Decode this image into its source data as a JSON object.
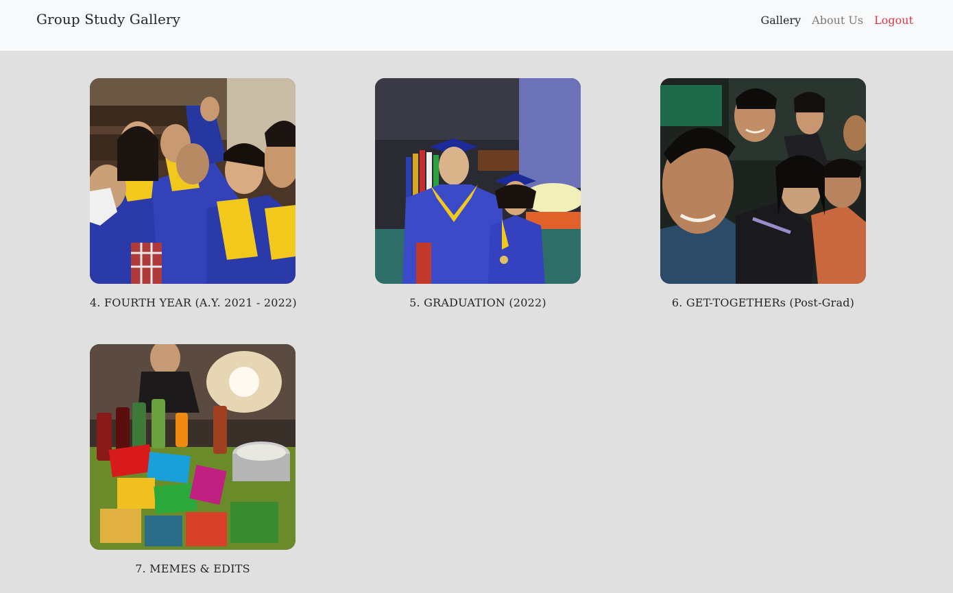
{
  "navbar": {
    "brand": "Group Study Gallery",
    "links": [
      {
        "label": "Gallery",
        "state": "active"
      },
      {
        "label": "About Us",
        "state": "inactive"
      },
      {
        "label": "Logout",
        "state": "danger"
      }
    ]
  },
  "gallery": {
    "albums": [
      {
        "title": "4. FOURTH YEAR (A.Y. 2021 - 2022)",
        "photo": "group selfie in blue and yellow graduation gowns"
      },
      {
        "title": "5. GRADUATION (2022)",
        "photo": "two graduates in blue caps and gowns on stage"
      },
      {
        "title": "6. GET-TOGETHERs (Post-Grad)",
        "photo": "night group selfie of friends"
      },
      {
        "title": "7. MEMES & EDITS",
        "photo": "table full of snacks and soft drinks"
      }
    ]
  },
  "colors": {
    "navbar_bg": "#f8f9fa",
    "page_bg": "#e0e0e0",
    "logout": "#dc3545",
    "gown_blue": "#2a3aa8",
    "gown_yellow": "#f2c81c"
  }
}
